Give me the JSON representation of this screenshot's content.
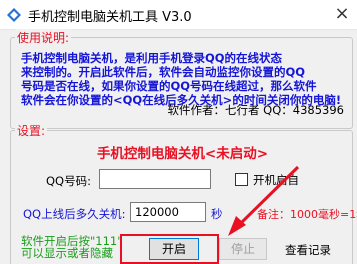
{
  "window": {
    "title": "手机控制电脑关机工具 V3.0",
    "close_glyph": "×"
  },
  "usage": {
    "legend": "使用说明:",
    "lines": [
      "手机控制电脑关机，是利用手机登录QQ的在线状态",
      "来控制的。开启此软件后，软件会自动监控你设置的QQ",
      "号码是否在线，如果你设置的QQ号码在线超过，那么软件",
      "软件会在你设置的<QQ在线后多久关机>的时间关闭你的电脑!"
    ],
    "author": "软件作者：七行者 QQ：4385396"
  },
  "settings": {
    "legend": "设置:",
    "status_title": "手机控制电脑关机<未启动>",
    "qq_label": "QQ号码:",
    "qq_value": "",
    "autostart_label": "开机启自",
    "delay_label": "QQ上线后多久关机:",
    "delay_value": "120000",
    "seconds_label": "秒",
    "note": "备注：1000毫秒=1秒",
    "hint_lines": [
      "软件开启后按\"111\"",
      "可以显示或者隐藏"
    ],
    "start_button": "开启",
    "stop_button": "停止",
    "log_link": "查看记录"
  },
  "colors": {
    "accent_red": "#e81123",
    "text_blue": "#1515d8",
    "hint_green": "#1a9e1a"
  }
}
